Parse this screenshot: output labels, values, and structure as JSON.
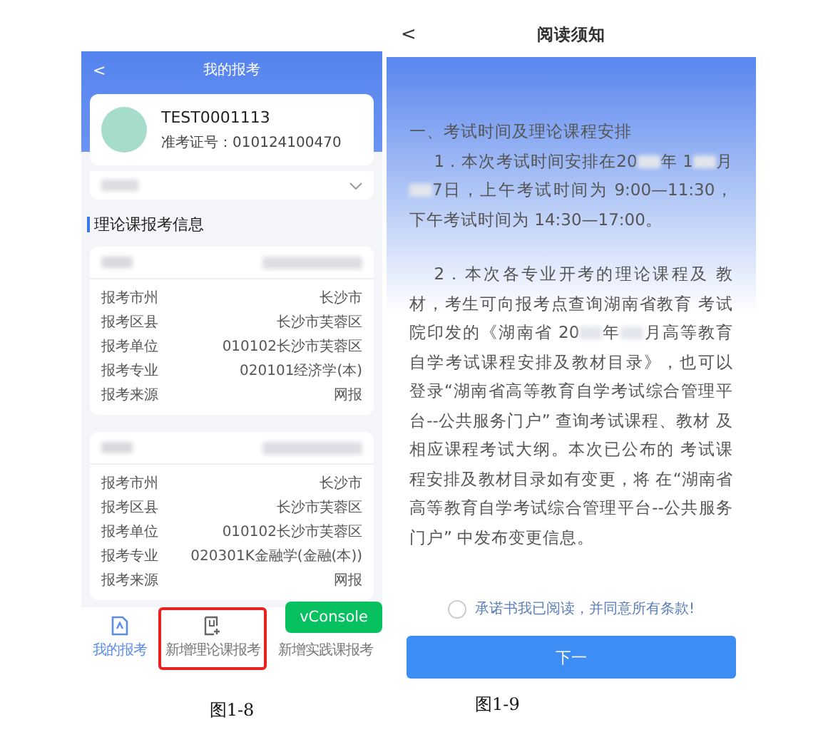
{
  "left_screen": {
    "header": {
      "back": "<",
      "title": "我的报考"
    },
    "profile": {
      "name": "TEST0001113",
      "exam_number": "准考证号：010124100470"
    },
    "section_title": "理论课报考信息",
    "cards": [
      {
        "rows": [
          {
            "label": "报考市州",
            "value": "长沙市"
          },
          {
            "label": "报考区县",
            "value": "长沙市芙蓉区"
          },
          {
            "label": "报考单位",
            "value": "010102长沙市芙蓉区"
          },
          {
            "label": "报考专业",
            "value": "020101经济学(本)"
          },
          {
            "label": "报考来源",
            "value": "网报"
          }
        ]
      },
      {
        "rows": [
          {
            "label": "报考市州",
            "value": "长沙市"
          },
          {
            "label": "报考区县",
            "value": "长沙市芙蓉区"
          },
          {
            "label": "报考单位",
            "value": "010102长沙市芙蓉区"
          },
          {
            "label": "报考专业",
            "value": "020301K金融学(金融(本))"
          },
          {
            "label": "报考来源",
            "value": "网报"
          }
        ]
      }
    ],
    "tabs": [
      {
        "label": "我的报考",
        "kind": "profile",
        "selected": true,
        "highlighted": false
      },
      {
        "label": "新增理论课报考",
        "kind": "add",
        "selected": false,
        "highlighted": true
      },
      {
        "label": "新增实践课报考",
        "kind": "covered",
        "selected": false,
        "highlighted": false
      }
    ],
    "floating_button": "vConsole",
    "caption": "图1-8"
  },
  "right_screen": {
    "header": {
      "back": "<",
      "title": "阅读须知"
    },
    "heading": "一、考试时间及理论课程安排",
    "paragraphs": [
      [
        {
          "text": "1．本次考试时间安排在20"
        },
        {
          "kind": "redacted"
        },
        {
          "text": "年 1"
        },
        {
          "kind": "redacted"
        },
        {
          "text": "月"
        },
        {
          "kind": "redacted"
        },
        {
          "text": "7日，上午考试时间为 9:00—11:30，下午考试时间为 14:30—17:00。"
        }
      ],
      [
        {
          "text": "2．本次各专业开考的理论课程及 教材，考生可向报考点查询湖南省教育 考试院印发的《湖南省 20"
        },
        {
          "kind": "redacted"
        },
        {
          "text": "年"
        },
        {
          "kind": "redacted"
        },
        {
          "text": "月高等教育自学考试课程安排及教材目录》，也可以登录“湖南省高等教育自学考试综合管理平台--公共服务门户” 查询考试课程、教材 及相应课程考试大纲。本次已公布的 考试课程安排及教材目录如有变更，将 在“湖南省高等教育自学考试综合管理平台--公共服务门户” 中发布变更信息。"
        }
      ]
    ],
    "agreement": {
      "label": "承诺书我已阅读，并同意所有条款!",
      "checked": false
    },
    "next_button": "下一",
    "caption": "图1-9"
  }
}
